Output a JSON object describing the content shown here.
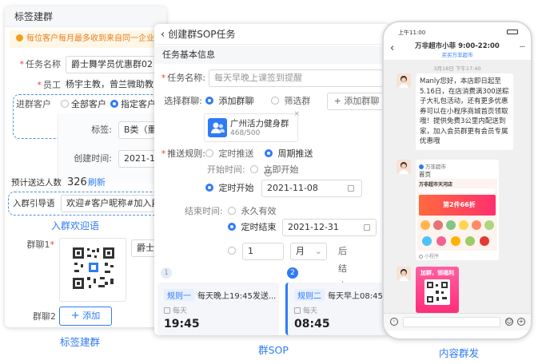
{
  "panel1": {
    "title": "标签建群",
    "notice": "每位客户每月最多收到来自同一企业",
    "task_name_label": "任务名称",
    "task_name_value": "爵士舞学员优惠群02",
    "staff_label": "员工",
    "staff_value": "杨宇主教，曾兰微助教",
    "customer_label": "进群客户",
    "opt_all": "全部客户",
    "opt_specified": "指定客户",
    "tag_label": "标签:",
    "tag_value": "B类（重要",
    "created_label": "创建时间:",
    "created_value": "2021-12-",
    "estimate_label": "预计送达人数",
    "estimate_value": "326",
    "refresh": "刷新",
    "guide_label": "入群引导语",
    "guide_value": "欢迎#客户昵称#加入爵士",
    "welcome_caption": "入群欢迎语",
    "group1_label": "群聊1",
    "group1_value": "爵士",
    "group2_label": "群聊2",
    "add_button": "添加"
  },
  "panel2": {
    "title": "创建群SOP任务",
    "section": "任务基本信息",
    "task_name_label": "任务名称:",
    "task_name_placeholder": "每天早晚上课签到提醒",
    "group_select_label": "选择群聊:",
    "opt_add_group": "添加群聊",
    "opt_filter_group": "筛选群聊",
    "add_group_button": "添加群聊",
    "group_card_name": "广州活力健身群",
    "group_card_count": "468/500",
    "push_rule_label": "推送规则:",
    "opt_timed": "定时推送",
    "opt_weekly": "周期推送",
    "start_time_label": "开始时间:",
    "opt_start_now": "立即开始",
    "opt_timed_start": "定时开始",
    "start_date": "2021-11-08",
    "end_time_label": "结束时间:",
    "opt_forever": "永久有效",
    "opt_timed_end": "定时结束",
    "end_date": "2021-12-31",
    "count_value": "1",
    "unit_value": "月",
    "after_end": "后结束",
    "rule1": {
      "no": "1",
      "tag": "规则一",
      "text": "每天晚上19:45发送...",
      "freq": "每天",
      "time": "19:45"
    },
    "rule2": {
      "no": "2",
      "tag": "规则二",
      "text": "每天早上08:45发送",
      "freq": "每天",
      "time": "08:45"
    }
  },
  "phone": {
    "status_time": "上午11:00",
    "chat_title": "万非超市小菲 9:00-22:00",
    "chat_subtitle": "买买万非超市",
    "timestamp": "3月18日 下午17:40",
    "message1": "Manly您好，本店即日起至5.16日，在店消费满300送粽子大礼包活动，还有更多优惠券可以在小程序商城首页领取哦！提供免费3公里内配送到家，加入会员群更有会员专属优惠哦",
    "mini_app_source": "万非超市",
    "mini_app_page": "首页",
    "mini_app_store": "万非超市天河店",
    "mini_app_banner": "第2件66折",
    "mini_app_footer": "小程序",
    "poster_title": "加群，领福利"
  },
  "captions": {
    "panel1": "标签建群",
    "panel2": "群SOP",
    "panel3": "内容群发"
  },
  "colors": {
    "accent": "#2f7bf5",
    "warning": "#e67e22",
    "required": "#f04040"
  }
}
